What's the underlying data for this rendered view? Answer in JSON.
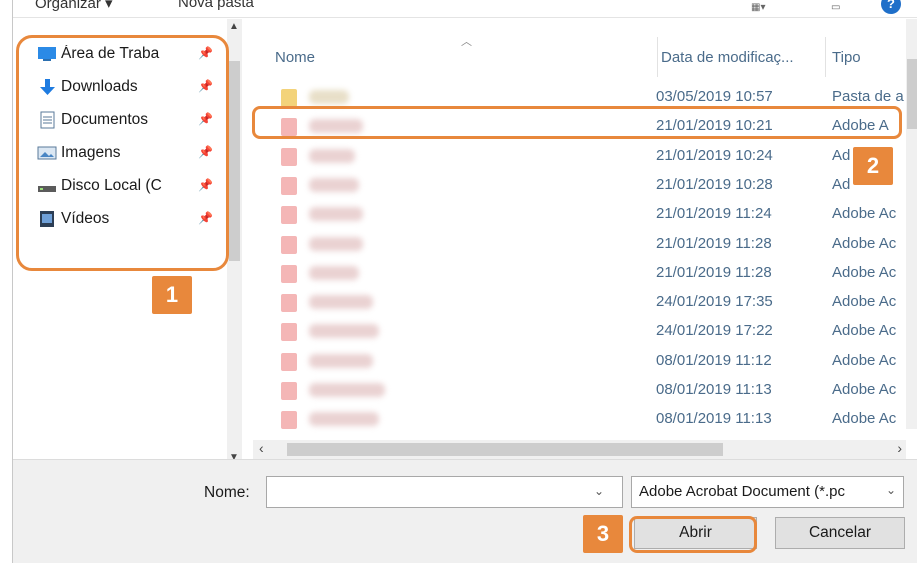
{
  "toolbar": {
    "organize_label": "Organizar ▾",
    "new_folder_label": "Nova pasta",
    "view_icon": "view-options-icon",
    "help_icon": "help-icon"
  },
  "nav": {
    "items": [
      {
        "label": "Área de Traba",
        "icon": "desktop-icon"
      },
      {
        "label": "Downloads",
        "icon": "download-arrow-icon"
      },
      {
        "label": "Documentos",
        "icon": "document-icon"
      },
      {
        "label": "Imagens",
        "icon": "pictures-icon"
      },
      {
        "label": "Disco Local (C",
        "icon": "drive-icon"
      },
      {
        "label": "Vídeos",
        "icon": "video-icon"
      }
    ]
  },
  "columns": {
    "name": "Nome",
    "date": "Data de modificaç...",
    "type": "Tipo"
  },
  "files": [
    {
      "date": "03/05/2019 10:57",
      "type": "Pasta de a",
      "kind": "folder"
    },
    {
      "date": "21/01/2019 10:21",
      "type": "Adobe A",
      "kind": "pdf"
    },
    {
      "date": "21/01/2019 10:24",
      "type": "Ad",
      "kind": "pdf"
    },
    {
      "date": "21/01/2019 10:28",
      "type": "Ad",
      "kind": "pdf"
    },
    {
      "date": "21/01/2019 11:24",
      "type": "Adobe Ac",
      "kind": "pdf"
    },
    {
      "date": "21/01/2019 11:28",
      "type": "Adobe Ac",
      "kind": "pdf"
    },
    {
      "date": "21/01/2019 11:28",
      "type": "Adobe Ac",
      "kind": "pdf"
    },
    {
      "date": "24/01/2019 17:35",
      "type": "Adobe Ac",
      "kind": "pdf"
    },
    {
      "date": "24/01/2019 17:22",
      "type": "Adobe Ac",
      "kind": "pdf"
    },
    {
      "date": "08/01/2019 11:12",
      "type": "Adobe Ac",
      "kind": "pdf"
    },
    {
      "date": "08/01/2019 11:13",
      "type": "Adobe Ac",
      "kind": "pdf"
    },
    {
      "date": "08/01/2019 11:13",
      "type": "Adobe Ac",
      "kind": "pdf"
    }
  ],
  "footer": {
    "name_label": "Nome:",
    "name_value": "",
    "filter_value": "Adobe Acrobat Document (*.pc",
    "open_label": "Abrir",
    "cancel_label": "Cancelar"
  },
  "annotations": {
    "badge_1": "1",
    "badge_2": "2",
    "badge_3": "3",
    "color": "#e8883c"
  },
  "colors": {
    "list_text": "#4a6b8a",
    "pdf_icon": "#f4b6b6",
    "folder_icon": "#f3d37a",
    "footer_bg": "#f0f0f0"
  }
}
